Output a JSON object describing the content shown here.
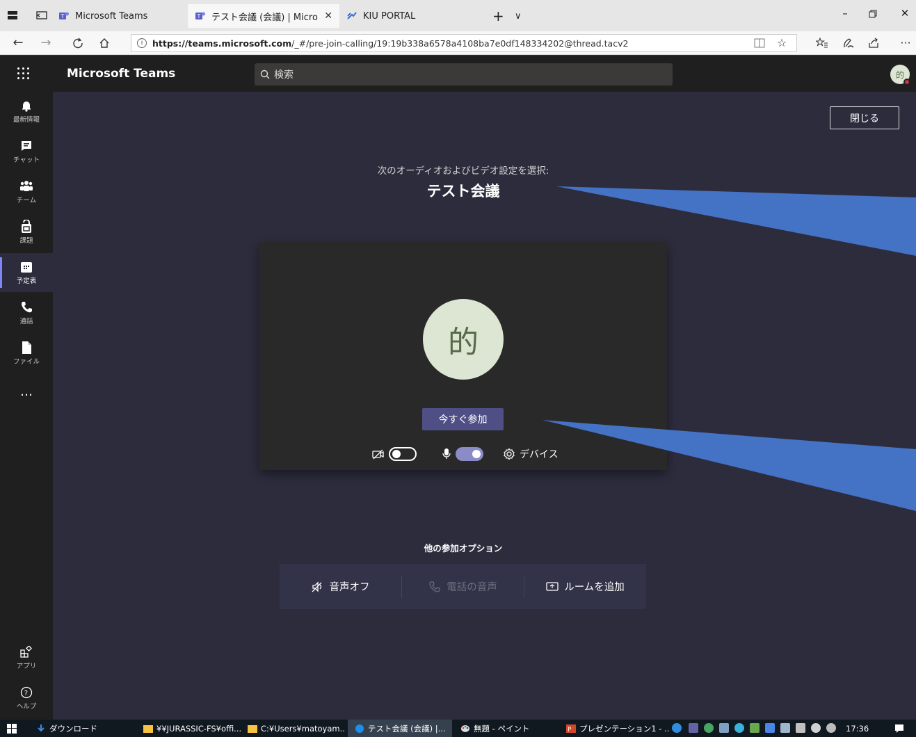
{
  "browser": {
    "tabs": [
      {
        "title": "Microsoft Teams",
        "active": false
      },
      {
        "title": "テスト会議 (会議) | Micro",
        "active": true
      },
      {
        "title": "KIU PORTAL",
        "active": false
      }
    ],
    "new_tab": "+",
    "tab_list": "∨",
    "url_host": "https://teams.microsoft.com",
    "url_path": "/_#/pre-join-calling/19:19b338a6578a4108ba7e0df148334202@thread.tacv2"
  },
  "teams": {
    "brand": "Microsoft Teams",
    "search_placeholder": "検索",
    "avatar_initial": "的"
  },
  "rail": {
    "items": [
      {
        "label": "最新情報",
        "icon": "bell-icon"
      },
      {
        "label": "チャット",
        "icon": "chat-icon"
      },
      {
        "label": "チーム",
        "icon": "teams-icon"
      },
      {
        "label": "課題",
        "icon": "assignments-icon"
      },
      {
        "label": "予定表",
        "icon": "calendar-icon",
        "active": true
      },
      {
        "label": "通話",
        "icon": "phone-icon"
      },
      {
        "label": "ファイル",
        "icon": "files-icon"
      }
    ],
    "more": "…",
    "apps_label": "アプリ",
    "help_label": "ヘルプ"
  },
  "prejoin": {
    "close_label": "閉じる",
    "subtitle": "次のオーディオおよびビデオ設定を選択:",
    "meeting_title": "テスト会議",
    "avatar_initial": "的",
    "join_label": "今すぐ参加",
    "camera_on": false,
    "mic_on": true,
    "devices_label": "デバイス",
    "other_options_title": "他の参加オプション",
    "options": [
      {
        "label": "音声オフ",
        "enabled": true
      },
      {
        "label": "電話の音声",
        "enabled": false
      },
      {
        "label": "ルームを追加",
        "enabled": true
      }
    ]
  },
  "taskbar": {
    "items": [
      {
        "label": "ダウンロード"
      },
      {
        "label": "¥¥JURASSIC-FS¥offi..."
      },
      {
        "label": "C:¥Users¥matoyam..."
      },
      {
        "label": "テスト会議 (会議) |...",
        "active": true
      },
      {
        "label": "無題 - ペイント"
      },
      {
        "label": "プレゼンテーション1 - ..."
      }
    ],
    "clock": "17:36"
  },
  "colors": {
    "accent": "#5b5fc7",
    "rail_bg": "#201f1f",
    "main_bg": "#2d2c3d",
    "callout": "#4472c4"
  }
}
